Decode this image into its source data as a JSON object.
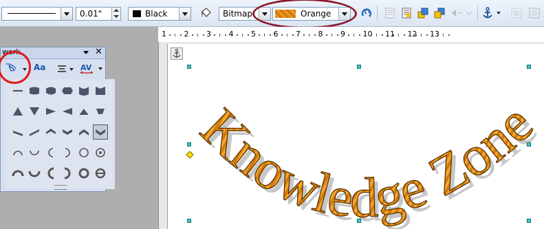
{
  "toolbar": {
    "line_width": "0.01\"",
    "line_color": "Black",
    "area_style": "Bitmap",
    "area_fill": "Orange"
  },
  "ruler": {
    "numbers": [
      "1",
      "2",
      "3",
      "4",
      "5",
      "6",
      "7",
      "8",
      "9",
      "10",
      "11",
      "12",
      "13"
    ]
  },
  "fontwork_panel": {
    "title": "work",
    "shape_button_label": "Fontwork shape",
    "same_letter_heights_label": "Aa"
  },
  "document": {
    "wordart_text": "Knowledge Zone"
  },
  "colors": {
    "fill_orange": "#e0870f",
    "annotation_red": "#e01818",
    "annotation_maroon": "#8b1a2b",
    "handle_cyan": "#40c8c8"
  },
  "icons": [
    "line-style-icon",
    "fill-bucket-icon",
    "rotate-icon",
    "bring-to-front-icon",
    "send-to-back-icon",
    "align-icon",
    "anchor-icon",
    "close-icon",
    "pin-icon",
    "fontwork-shape-icon",
    "letter-height-icon",
    "alignment-icon",
    "character-spacing-icon",
    "anchor-marker-icon"
  ]
}
